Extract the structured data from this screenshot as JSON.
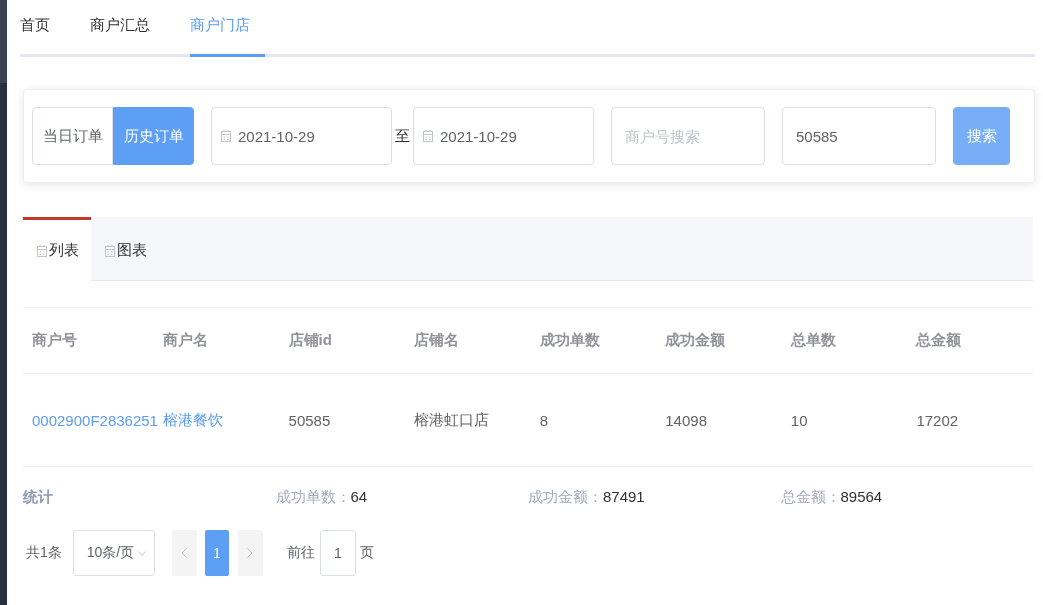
{
  "nav_tabs": [
    {
      "label": "首页",
      "selected": false
    },
    {
      "label": "商户汇总",
      "selected": false
    },
    {
      "label": "商户门店",
      "selected": true
    }
  ],
  "filter": {
    "order_type": [
      {
        "label": "当日订单",
        "selected": false
      },
      {
        "label": "历史订单",
        "selected": true
      }
    ],
    "start_date": {
      "value": "2021-10-29"
    },
    "range_separator": "至",
    "end_date": {
      "value": "2021-10-29"
    },
    "merchant_search": {
      "placeholder": "商户号搜索"
    },
    "store_search": {
      "value": "50585"
    },
    "search_button": "搜索"
  },
  "view_tabs": [
    {
      "label": "列表",
      "selected": true
    },
    {
      "label": "图表",
      "selected": false
    }
  ],
  "table": {
    "columns": [
      "商户号",
      "商户名",
      "店铺id",
      "店铺名",
      "成功单数",
      "成功金额",
      "总单数",
      "总金额"
    ],
    "rows": [
      {
        "cells": [
          {
            "kind": "link",
            "text": "0002900F2836251"
          },
          {
            "kind": "link",
            "text": "榕港餐饮"
          },
          {
            "kind": "text",
            "text": "50585"
          },
          {
            "kind": "text",
            "text": "榕港虹口店"
          },
          {
            "kind": "text",
            "text": "8"
          },
          {
            "kind": "text",
            "text": "14098"
          },
          {
            "kind": "text",
            "text": "10"
          },
          {
            "kind": "text",
            "text": "17202"
          }
        ]
      }
    ]
  },
  "summary": {
    "title": "统计",
    "items": [
      {
        "label": "成功单数：",
        "value": "64"
      },
      {
        "label": "成功金额：",
        "value": "87491"
      },
      {
        "label": "总金额：",
        "value": "89564"
      }
    ]
  },
  "pagination": {
    "total": "共1条",
    "page_size": "10条/页",
    "prev": {
      "disabled": true
    },
    "pages": [
      {
        "label": "1",
        "selected": true
      }
    ],
    "next": {
      "disabled": true
    },
    "goto_label": "前往",
    "goto_value": "1",
    "goto_suffix": "页"
  }
}
